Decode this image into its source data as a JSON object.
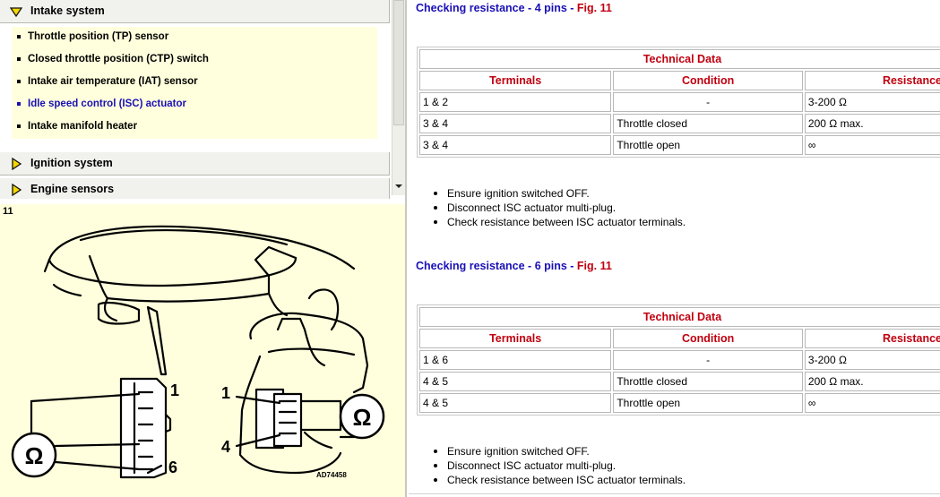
{
  "nav": {
    "categories": [
      {
        "label": "Intake system",
        "expanded": true
      },
      {
        "label": "Ignition system",
        "expanded": false
      },
      {
        "label": "Engine sensors",
        "expanded": false
      }
    ],
    "intake_items": [
      {
        "label": "Throttle position (TP) sensor",
        "active": false
      },
      {
        "label": "Closed throttle position (CTP) switch",
        "active": false
      },
      {
        "label": "Intake air temperature (IAT) sensor",
        "active": false
      },
      {
        "label": "Idle speed control (ISC) actuator",
        "active": true
      },
      {
        "label": "Intake manifold heater",
        "active": false
      }
    ]
  },
  "figure": {
    "number": "11",
    "callouts": {
      "pin1_left": "1",
      "pin6_left": "6",
      "pin1_right": "1",
      "pin4_right": "4"
    },
    "ohm_symbol": "Ω",
    "code": "AD74458"
  },
  "sections": [
    {
      "title_blue": "Checking resistance - 4 pins - ",
      "title_red": "Fig. 11",
      "table_title": "Technical Data",
      "headers": [
        "Terminals",
        "Condition",
        "Resistance"
      ],
      "rows": [
        [
          "1 & 2",
          "-",
          "3-200 Ω"
        ],
        [
          "3 & 4",
          "Throttle closed",
          "200 Ω max."
        ],
        [
          "3 & 4",
          "Throttle open",
          " ∞"
        ]
      ],
      "steps": [
        "Ensure ignition switched OFF.",
        "Disconnect ISC actuator multi-plug.",
        "Check resistance between ISC actuator terminals."
      ]
    },
    {
      "title_blue": "Checking resistance - 6 pins - ",
      "title_red": "Fig. 11",
      "table_title": "Technical Data",
      "headers": [
        "Terminals",
        "Condition",
        "Resistance"
      ],
      "rows": [
        [
          "1 & 6",
          "-",
          "3-200 Ω"
        ],
        [
          "4 & 5",
          "Throttle closed",
          "200 Ω max."
        ],
        [
          "4 & 5",
          "Throttle open",
          " ∞"
        ]
      ],
      "steps": [
        "Ensure ignition switched OFF.",
        "Disconnect ISC actuator multi-plug.",
        "Check resistance between ISC actuator terminals."
      ]
    }
  ],
  "colors": {
    "link_blue": "#1a10b5",
    "heading_red": "#c0000f",
    "figure_bg": "#ffffdd",
    "nav_bg": "#f1f1ed"
  },
  "icons": {
    "category": "yellow-arrow-icon"
  }
}
